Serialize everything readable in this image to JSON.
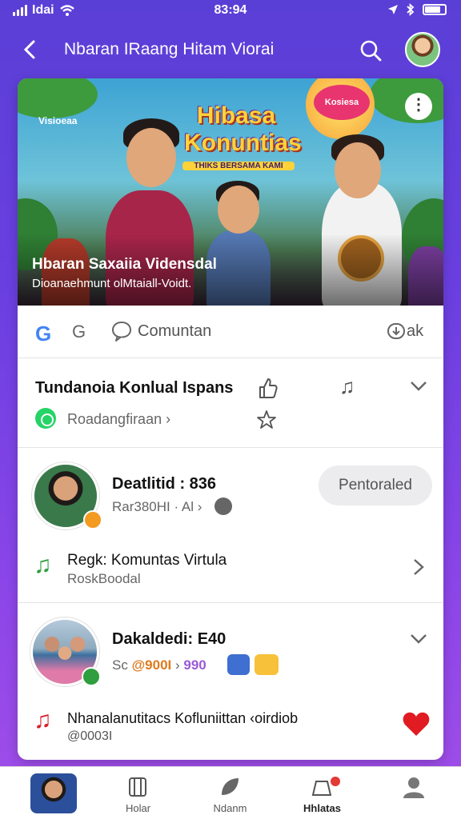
{
  "status": {
    "carrier": "Idai",
    "time": "83:94",
    "battery_level": 0.8
  },
  "nav": {
    "title": "Nbaran  IRaang Hitam  Viorai"
  },
  "hero": {
    "brand": "Visioeaa",
    "logo_line1": "Hibasa",
    "logo_line2": "Konuntias",
    "logo_sub": "THIKS BERSAMA KAMI",
    "badge": "Kosiesa",
    "title": "Hbaran Saxaiia Vidensdal",
    "subtitle": "Dioanaehmunt olMtaiall-Voidt."
  },
  "actions": {
    "g_label": "G",
    "g2_label": "G",
    "comment_label": "Comuntan",
    "share_label": "ak"
  },
  "trend": {
    "title": "Tundanoia Konlual Ispans",
    "subtitle": "Roadangfiraan ›"
  },
  "user1": {
    "name": "Deatlitid : 836",
    "meta": "Rar380HI · Al ›",
    "follow_label": "Pentoraled",
    "community_title": "Regk: Komuntas Virtula",
    "community_sub": "RoskBoodal"
  },
  "user2": {
    "name": "Dakaldedi: E40",
    "meta_prefix": "Sc",
    "meta_value1": "@900I",
    "meta_sep": "›",
    "meta_value2": "990",
    "community_title": "Nhanalanutitacs Kofluniittan ‹oirdiob",
    "community_sub": "@0003I"
  },
  "tabs": [
    {
      "label": ""
    },
    {
      "label": "Holar"
    },
    {
      "label": "Ndanm"
    },
    {
      "label": "Hhlatas"
    },
    {
      "label": ""
    }
  ],
  "colors": {
    "accent": "#6a3fe0",
    "green": "#2e9e3e",
    "red": "#d6202a"
  }
}
